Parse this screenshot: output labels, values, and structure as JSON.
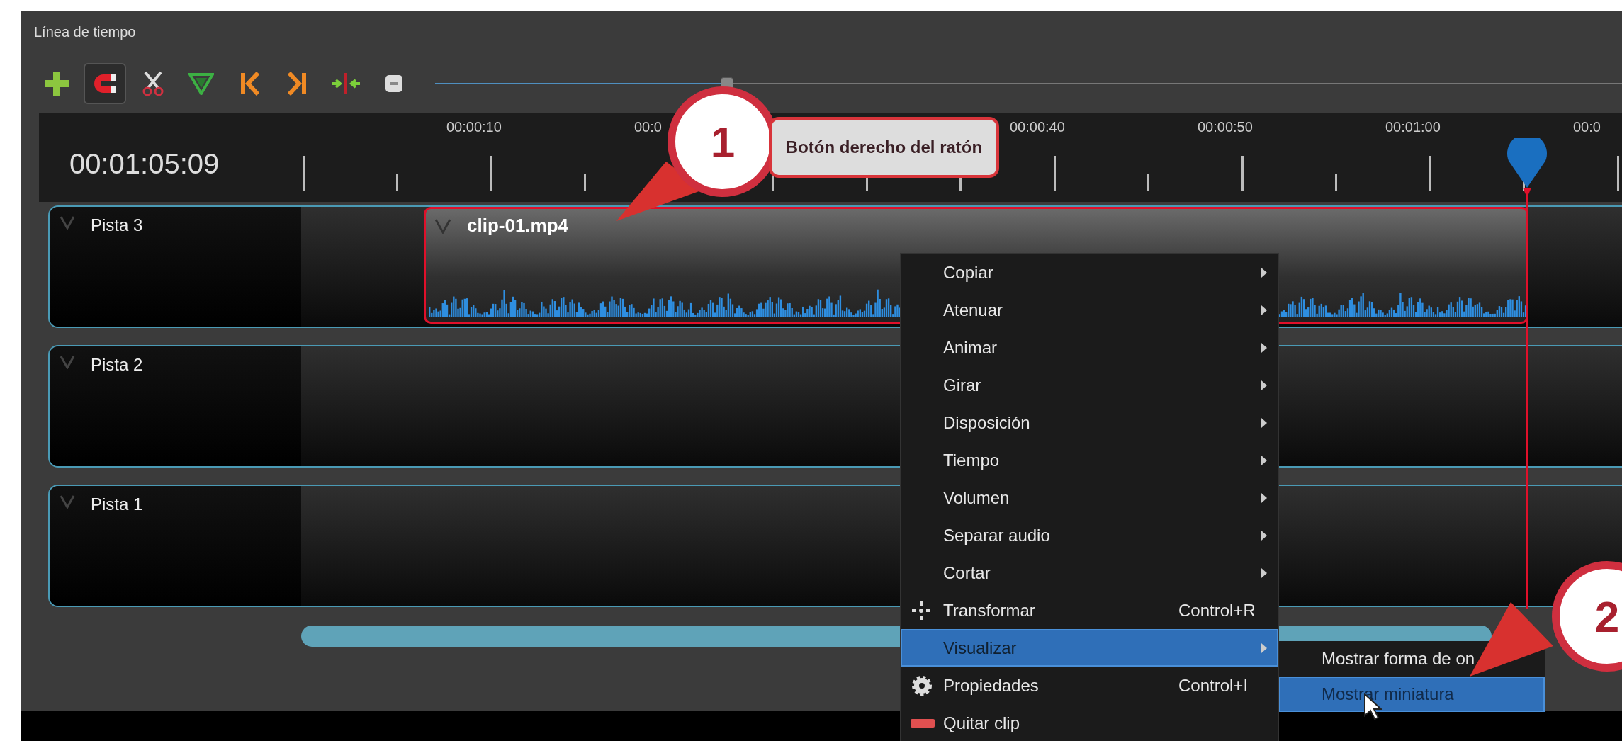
{
  "panel": {
    "title": "Línea de tiempo"
  },
  "toolbar": {
    "tools": [
      {
        "kind": "add",
        "on": false
      },
      {
        "kind": "snap",
        "on": true
      },
      {
        "kind": "razor",
        "on": false
      },
      {
        "kind": "marker",
        "on": false
      },
      {
        "kind": "previous",
        "on": false
      },
      {
        "kind": "next",
        "on": false
      },
      {
        "kind": "center",
        "on": false
      },
      {
        "kind": "zoom",
        "on": false
      }
    ],
    "zoom_slider": {
      "level": 0.24
    }
  },
  "ruler": {
    "timecode": "00:01:05:09",
    "labels": [
      "00:00:10",
      "00:0",
      "00:00:40",
      "00:00:50",
      "00:01:00",
      "00:0"
    ]
  },
  "tracks": [
    {
      "name": "Pista 3",
      "clips": [
        {
          "name": "clip-01.mp4",
          "selected": true
        }
      ]
    },
    {
      "name": "Pista 2"
    },
    {
      "name": "Pista 1"
    }
  ],
  "context_menu": {
    "items": [
      {
        "label": "Copiar",
        "kind": "submenu",
        "selected": false
      },
      {
        "label": "Atenuar",
        "kind": "submenu",
        "selected": false
      },
      {
        "label": "Animar",
        "kind": "submenu",
        "selected": false
      },
      {
        "label": "Girar",
        "kind": "submenu",
        "selected": false
      },
      {
        "label": "Disposición",
        "kind": "submenu",
        "selected": false
      },
      {
        "label": "Tiempo",
        "kind": "submenu",
        "selected": false
      },
      {
        "label": "Volumen",
        "kind": "submenu",
        "selected": false
      },
      {
        "label": "Separar audio",
        "kind": "submenu",
        "selected": false
      },
      {
        "label": "Cortar",
        "kind": "submenu",
        "selected": false
      },
      {
        "label": "Transformar",
        "kind": "transform",
        "shortcut": "Control+R",
        "selected": false
      },
      {
        "label": "Visualizar",
        "kind": "submenu",
        "selected": true
      },
      {
        "label": "Propiedades",
        "kind": "properties",
        "shortcut": "Control+I",
        "selected": false
      },
      {
        "label": "Quitar clip",
        "kind": "remove",
        "selected": false
      }
    ]
  },
  "submenu": {
    "items": [
      {
        "label": "Mostrar forma de on",
        "selected": false
      },
      {
        "label": "Mostrar miniatura",
        "selected": true
      }
    ]
  },
  "annotations": [
    {
      "number": "1",
      "label": "Botón derecho del ratón"
    },
    {
      "number": "2"
    }
  ]
}
